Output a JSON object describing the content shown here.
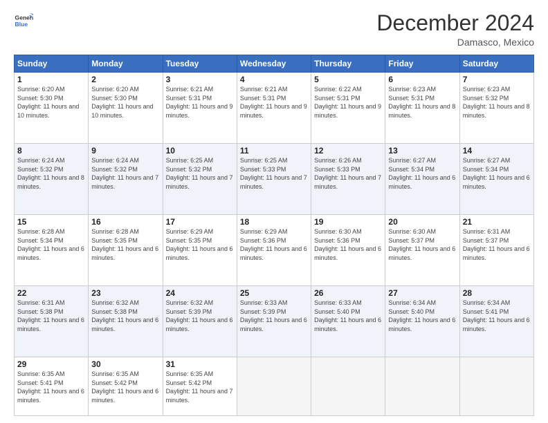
{
  "header": {
    "logo_line1": "General",
    "logo_line2": "Blue",
    "month": "December 2024",
    "location": "Damasco, Mexico"
  },
  "days_of_week": [
    "Sunday",
    "Monday",
    "Tuesday",
    "Wednesday",
    "Thursday",
    "Friday",
    "Saturday"
  ],
  "weeks": [
    [
      {
        "day": "1",
        "sunrise": "6:20 AM",
        "sunset": "5:30 PM",
        "daylight": "11 hours and 10 minutes."
      },
      {
        "day": "2",
        "sunrise": "6:20 AM",
        "sunset": "5:30 PM",
        "daylight": "11 hours and 10 minutes."
      },
      {
        "day": "3",
        "sunrise": "6:21 AM",
        "sunset": "5:31 PM",
        "daylight": "11 hours and 9 minutes."
      },
      {
        "day": "4",
        "sunrise": "6:21 AM",
        "sunset": "5:31 PM",
        "daylight": "11 hours and 9 minutes."
      },
      {
        "day": "5",
        "sunrise": "6:22 AM",
        "sunset": "5:31 PM",
        "daylight": "11 hours and 9 minutes."
      },
      {
        "day": "6",
        "sunrise": "6:23 AM",
        "sunset": "5:31 PM",
        "daylight": "11 hours and 8 minutes."
      },
      {
        "day": "7",
        "sunrise": "6:23 AM",
        "sunset": "5:32 PM",
        "daylight": "11 hours and 8 minutes."
      }
    ],
    [
      {
        "day": "8",
        "sunrise": "6:24 AM",
        "sunset": "5:32 PM",
        "daylight": "11 hours and 8 minutes."
      },
      {
        "day": "9",
        "sunrise": "6:24 AM",
        "sunset": "5:32 PM",
        "daylight": "11 hours and 7 minutes."
      },
      {
        "day": "10",
        "sunrise": "6:25 AM",
        "sunset": "5:32 PM",
        "daylight": "11 hours and 7 minutes."
      },
      {
        "day": "11",
        "sunrise": "6:25 AM",
        "sunset": "5:33 PM",
        "daylight": "11 hours and 7 minutes."
      },
      {
        "day": "12",
        "sunrise": "6:26 AM",
        "sunset": "5:33 PM",
        "daylight": "11 hours and 7 minutes."
      },
      {
        "day": "13",
        "sunrise": "6:27 AM",
        "sunset": "5:34 PM",
        "daylight": "11 hours and 6 minutes."
      },
      {
        "day": "14",
        "sunrise": "6:27 AM",
        "sunset": "5:34 PM",
        "daylight": "11 hours and 6 minutes."
      }
    ],
    [
      {
        "day": "15",
        "sunrise": "6:28 AM",
        "sunset": "5:34 PM",
        "daylight": "11 hours and 6 minutes."
      },
      {
        "day": "16",
        "sunrise": "6:28 AM",
        "sunset": "5:35 PM",
        "daylight": "11 hours and 6 minutes."
      },
      {
        "day": "17",
        "sunrise": "6:29 AM",
        "sunset": "5:35 PM",
        "daylight": "11 hours and 6 minutes."
      },
      {
        "day": "18",
        "sunrise": "6:29 AM",
        "sunset": "5:36 PM",
        "daylight": "11 hours and 6 minutes."
      },
      {
        "day": "19",
        "sunrise": "6:30 AM",
        "sunset": "5:36 PM",
        "daylight": "11 hours and 6 minutes."
      },
      {
        "day": "20",
        "sunrise": "6:30 AM",
        "sunset": "5:37 PM",
        "daylight": "11 hours and 6 minutes."
      },
      {
        "day": "21",
        "sunrise": "6:31 AM",
        "sunset": "5:37 PM",
        "daylight": "11 hours and 6 minutes."
      }
    ],
    [
      {
        "day": "22",
        "sunrise": "6:31 AM",
        "sunset": "5:38 PM",
        "daylight": "11 hours and 6 minutes."
      },
      {
        "day": "23",
        "sunrise": "6:32 AM",
        "sunset": "5:38 PM",
        "daylight": "11 hours and 6 minutes."
      },
      {
        "day": "24",
        "sunrise": "6:32 AM",
        "sunset": "5:39 PM",
        "daylight": "11 hours and 6 minutes."
      },
      {
        "day": "25",
        "sunrise": "6:33 AM",
        "sunset": "5:39 PM",
        "daylight": "11 hours and 6 minutes."
      },
      {
        "day": "26",
        "sunrise": "6:33 AM",
        "sunset": "5:40 PM",
        "daylight": "11 hours and 6 minutes."
      },
      {
        "day": "27",
        "sunrise": "6:34 AM",
        "sunset": "5:40 PM",
        "daylight": "11 hours and 6 minutes."
      },
      {
        "day": "28",
        "sunrise": "6:34 AM",
        "sunset": "5:41 PM",
        "daylight": "11 hours and 6 minutes."
      }
    ],
    [
      {
        "day": "29",
        "sunrise": "6:35 AM",
        "sunset": "5:41 PM",
        "daylight": "11 hours and 6 minutes."
      },
      {
        "day": "30",
        "sunrise": "6:35 AM",
        "sunset": "5:42 PM",
        "daylight": "11 hours and 6 minutes."
      },
      {
        "day": "31",
        "sunrise": "6:35 AM",
        "sunset": "5:42 PM",
        "daylight": "11 hours and 7 minutes."
      },
      null,
      null,
      null,
      null
    ]
  ]
}
